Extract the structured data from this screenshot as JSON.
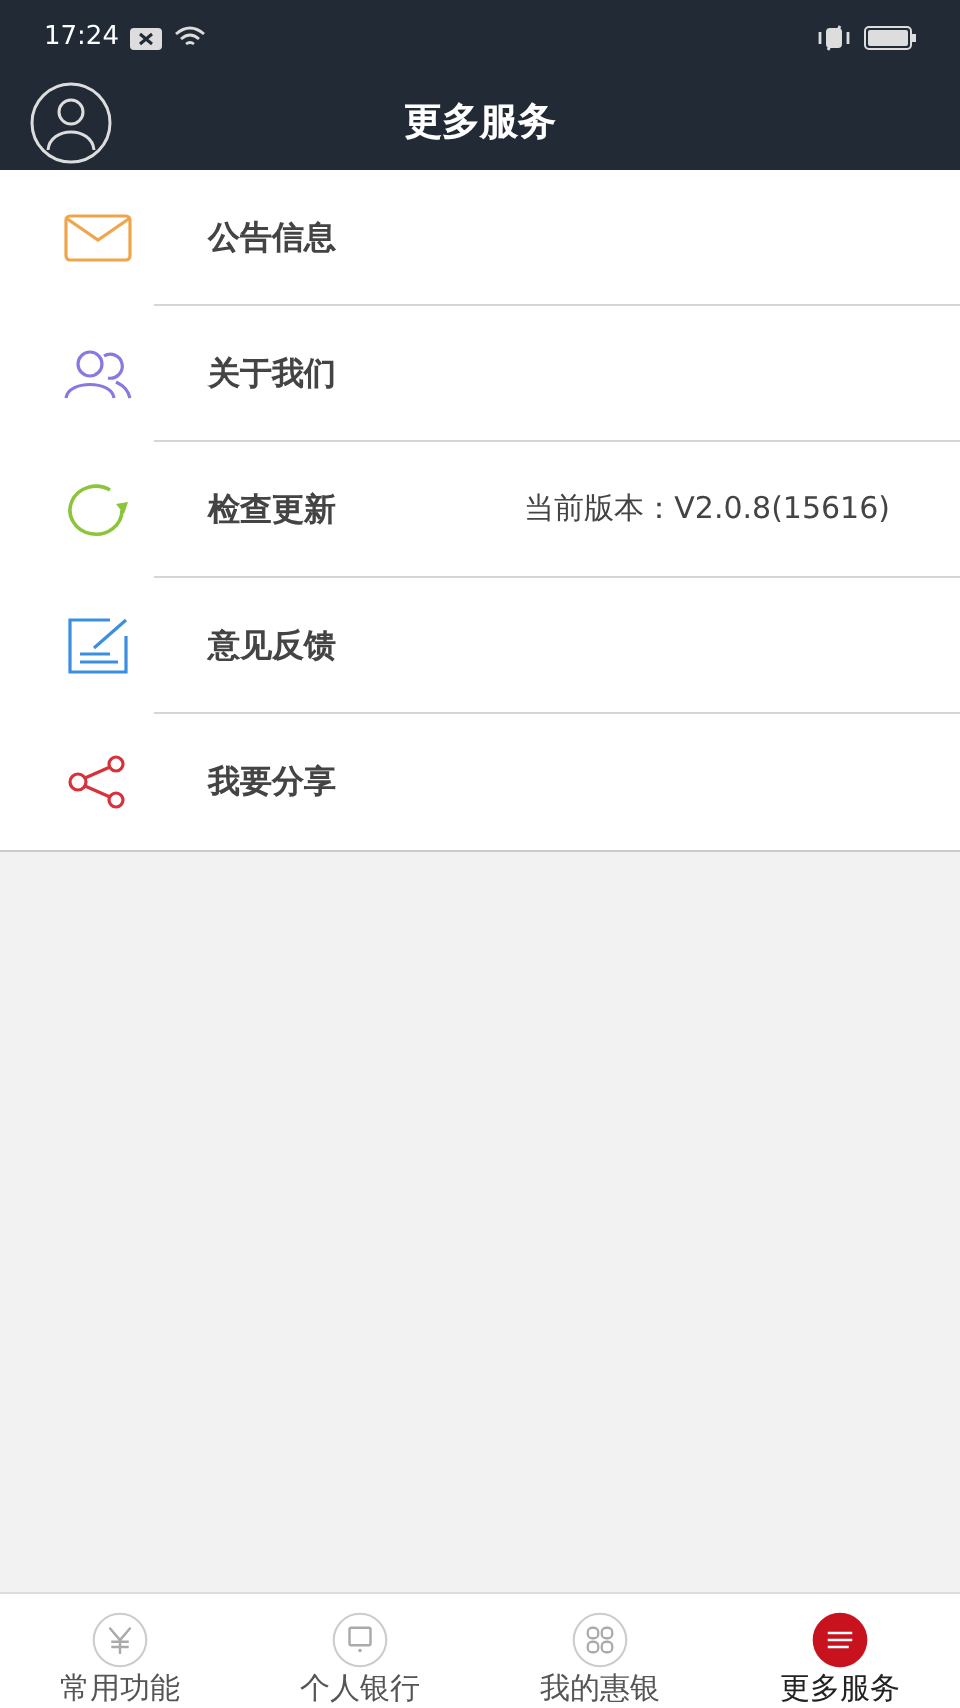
{
  "status_bar": {
    "time": "17:24"
  },
  "header": {
    "title": "更多服务"
  },
  "menu": [
    {
      "label": "公告信息"
    },
    {
      "label": "关于我们"
    },
    {
      "label": "检查更新",
      "value": "当前版本：V2.0.8(15616)"
    },
    {
      "label": "意见反馈"
    },
    {
      "label": "我要分享"
    }
  ],
  "tabs": [
    {
      "label": "常用功能",
      "selected": false
    },
    {
      "label": "个人银行",
      "selected": false
    },
    {
      "label": "我的惠银",
      "selected": false
    },
    {
      "label": "更多服务",
      "selected": true
    }
  ]
}
